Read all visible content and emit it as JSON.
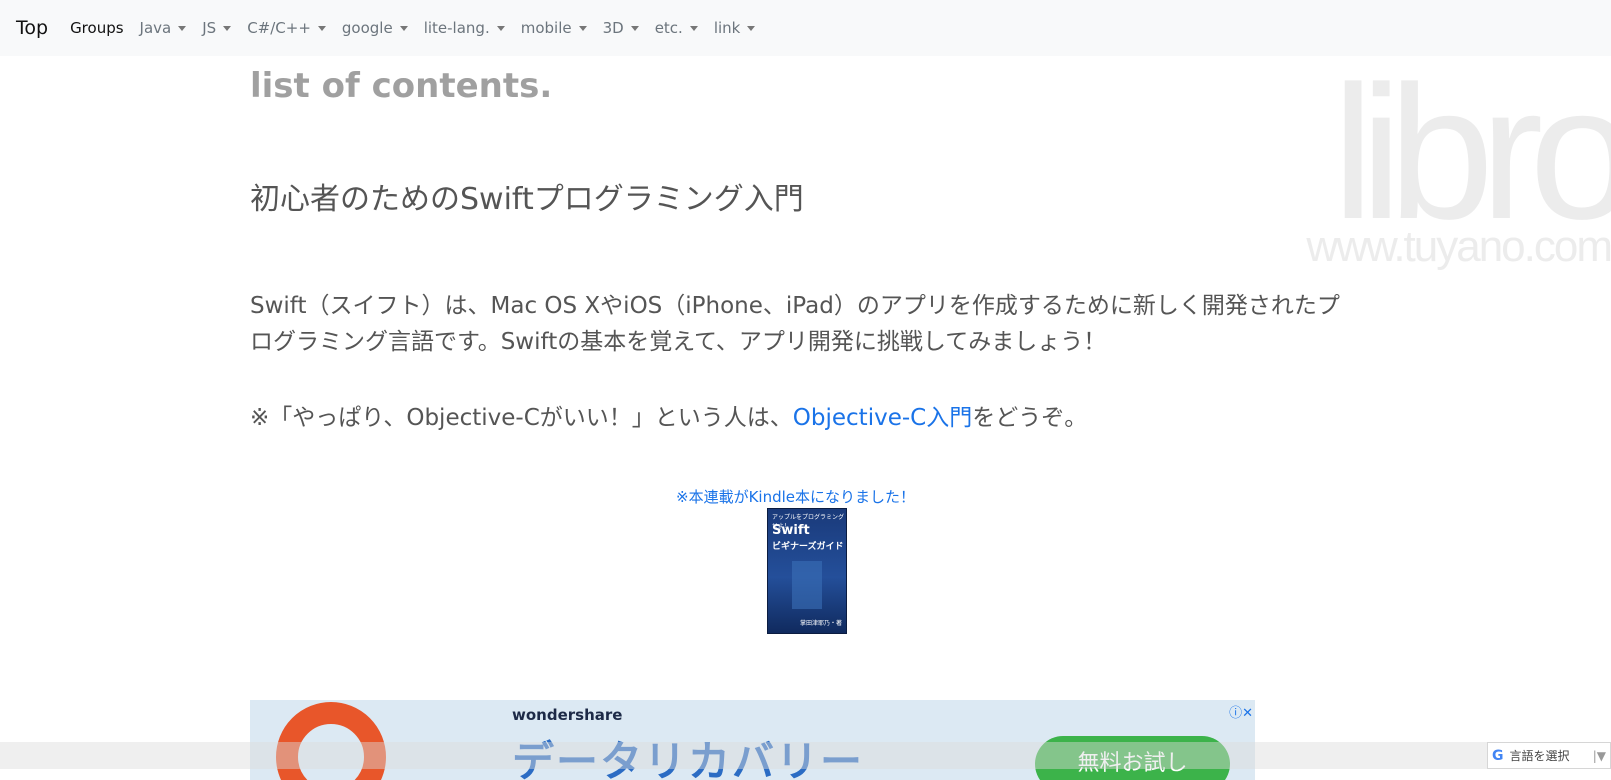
{
  "nav": {
    "brand": "Top",
    "items": [
      {
        "label": "Groups",
        "active": true,
        "dropdown": false
      },
      {
        "label": "Java",
        "dropdown": true
      },
      {
        "label": "JS",
        "dropdown": true
      },
      {
        "label": "C#/C++",
        "dropdown": true
      },
      {
        "label": "google",
        "dropdown": true
      },
      {
        "label": "lite-lang.",
        "dropdown": true
      },
      {
        "label": "mobile",
        "dropdown": true
      },
      {
        "label": "3D",
        "dropdown": true
      },
      {
        "label": "etc.",
        "dropdown": true
      },
      {
        "label": "link",
        "dropdown": true
      }
    ]
  },
  "watermark": {
    "logo": "libro",
    "url": "www.tuyano.com"
  },
  "content": {
    "location_title": "list of contents.",
    "page_title": "初心者のためのSwiftプログラミング入門",
    "intro": "Swift（スイフト）は、Mac OS XやiOS（iPhone、iPad）のアプリを作成するために新しく開発されたプログラミング言語です。Swiftの基本を覚えて、アプリ開発に挑戦してみましょう！",
    "note_prefix": "※「やっぱり、Objective-Cがいい！」という人は、",
    "note_link": "Objective-C入門",
    "note_suffix": "をどうぞ。",
    "kindle_link": "※本連載がKindle本になりました！",
    "book": {
      "series": "アップルをプログラミングせよ！",
      "title": "Swift",
      "subtitle": "ビギナーズガイド",
      "author": "掌田津耶乃・著"
    }
  },
  "ad": {
    "brand": "wondershare",
    "headline": "データリカバリー",
    "cta": "無料お試し"
  },
  "translate": {
    "label": "言語を選択",
    "icon": "google-g-icon"
  }
}
